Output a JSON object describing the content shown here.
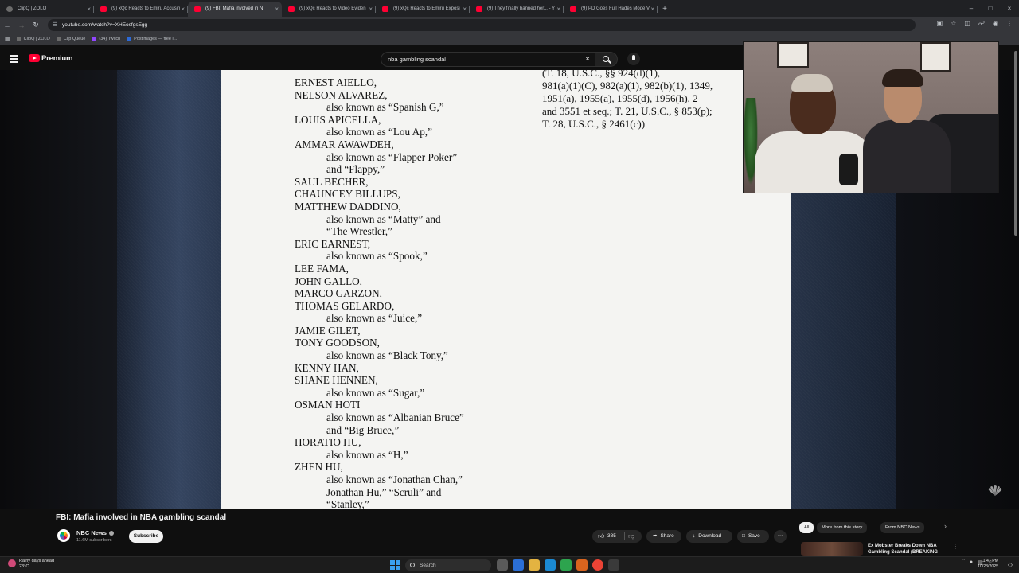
{
  "browser": {
    "tabs": [
      {
        "title": "ClipQ | ZOLO",
        "favicon": "clipq",
        "active": false
      },
      {
        "title": "(9) xQc Reacts to Emiru Accusin",
        "favicon": "youtube",
        "active": false
      },
      {
        "title": "(9) FBI: Mafia involved in N",
        "favicon": "youtube",
        "active": true
      },
      {
        "title": "(9) xQc Reacts to Video Eviden",
        "favicon": "youtube",
        "active": false
      },
      {
        "title": "(9) xQc Reacts to Emiru Exposi",
        "favicon": "youtube",
        "active": false
      },
      {
        "title": "(9) They finally banned her... - Y",
        "favicon": "youtube",
        "active": false
      },
      {
        "title": "(9) PD Goes Full Hades Mode V",
        "favicon": "youtube",
        "active": false
      }
    ],
    "url": "youtube.com/watch?v=XHEosfgsEgg",
    "bookmarks": [
      {
        "label": "ClipQ | ZOLO",
        "icon": "clipq-icon"
      },
      {
        "label": "Clip Queue",
        "icon": "clip-queue-icon"
      },
      {
        "label": "(34) Twitch",
        "icon": "twitch-icon"
      },
      {
        "label": "Postimages — free i...",
        "icon": "postimages-icon"
      }
    ]
  },
  "youtube": {
    "brand": "Premium",
    "search_query": "nba gambling scandal"
  },
  "document": {
    "names": [
      {
        "text": "ERNEST AIELLO,",
        "aka": false
      },
      {
        "text": "NELSON ALVAREZ,",
        "aka": false
      },
      {
        "text": "also known as “Spanish G,”",
        "aka": true
      },
      {
        "text": "LOUIS APICELLA,",
        "aka": false
      },
      {
        "text": "also known as “Lou Ap,”",
        "aka": true
      },
      {
        "text": "AMMAR AWAWDEH,",
        "aka": false
      },
      {
        "text": "also known as “Flapper Poker”",
        "aka": true
      },
      {
        "text": "and “Flappy,”",
        "aka": true
      },
      {
        "text": "SAUL BECHER,",
        "aka": false
      },
      {
        "text": "CHAUNCEY BILLUPS,",
        "aka": false
      },
      {
        "text": "MATTHEW DADDINO,",
        "aka": false
      },
      {
        "text": "also known as “Matty” and",
        "aka": true
      },
      {
        "text": "“The Wrestler,”",
        "aka": true
      },
      {
        "text": "ERIC EARNEST,",
        "aka": false
      },
      {
        "text": "also known as “Spook,”",
        "aka": true
      },
      {
        "text": "LEE FAMA,",
        "aka": false
      },
      {
        "text": "JOHN GALLO,",
        "aka": false
      },
      {
        "text": "MARCO GARZON,",
        "aka": false
      },
      {
        "text": "THOMAS GELARDO,",
        "aka": false
      },
      {
        "text": "also known as “Juice,”",
        "aka": true
      },
      {
        "text": "JAMIE GILET,",
        "aka": false
      },
      {
        "text": "TONY GOODSON,",
        "aka": false
      },
      {
        "text": "also known as “Black Tony,”",
        "aka": true
      },
      {
        "text": "KENNY HAN,",
        "aka": false
      },
      {
        "text": "SHANE HENNEN,",
        "aka": false
      },
      {
        "text": "also known as “Sugar,”",
        "aka": true
      },
      {
        "text": "OSMAN HOTI",
        "aka": false
      },
      {
        "text": "also known as “Albanian Bruce”",
        "aka": true
      },
      {
        "text": "and “Big Bruce,”",
        "aka": true
      },
      {
        "text": "HORATIO HU,",
        "aka": false
      },
      {
        "text": "also known as “H,”",
        "aka": true
      },
      {
        "text": "ZHEN HU,",
        "aka": false
      },
      {
        "text": "also known as “Jonathan Chan,”",
        "aka": true
      },
      {
        "text": "Jonathan Hu,” “Scruli” and",
        "aka": true
      },
      {
        "text": "“Stanley,”",
        "aka": true
      }
    ],
    "citation": [
      "(T. 18, U.S.C., §§ 924(d)(1),",
      "981(a)(1)(C), 982(a)(1), 982(b)(1), 1349,",
      "1951(a), 1955(a), 1955(d), 1956(h), 2",
      "and 3551 et seq.; T. 21, U.S.C., § 853(p);",
      "T. 28, U.S.C., § 2461(c))"
    ]
  },
  "video": {
    "title": "FBI: Mafia involved in NBA gambling scandal",
    "channel": "NBC News",
    "subscribers": "11.6M subscribers",
    "subscribe_label": "Subscribe",
    "likes": "385",
    "share_label": "Share",
    "download_label": "Download",
    "save_label": "Save"
  },
  "sidebar": {
    "chips": [
      "All",
      "More from this story",
      "From NBC News"
    ],
    "recommendation": {
      "title": "Ex Mobster Breaks Down NBA Gambling Scandal (BREAKING"
    }
  },
  "taskbar": {
    "weather_line1": "Rainy days ahead",
    "weather_line2": "23°C",
    "search_placeholder": "Search",
    "time": "11:47 PM",
    "date": "10/23/2025"
  },
  "colors": {
    "youtube_red": "#ff0033",
    "background": "#0f0f0f",
    "chip_selected": "#f1f1f1"
  }
}
